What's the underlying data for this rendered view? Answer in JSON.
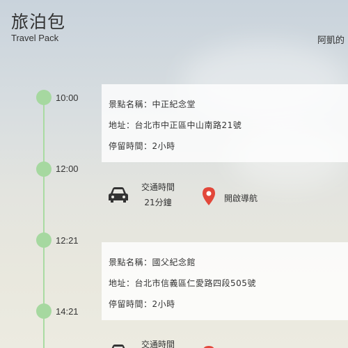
{
  "header": {
    "title": "旅泊包",
    "subtitle": "Travel Pack",
    "user": "阿凱的"
  },
  "timeline": [
    {
      "time": "10:00"
    },
    {
      "time": "12:00"
    },
    {
      "time": "12:21"
    },
    {
      "time": "14:21"
    }
  ],
  "stops": [
    {
      "name": "景點名稱：中正紀念堂",
      "address": "地址：台北市中正區中山南路21號",
      "duration": "停留時間：2小時"
    },
    {
      "name": "景點名稱：國父紀念館",
      "address": "地址：台北市信義區仁愛路四段505號",
      "duration": "停留時間：2小時"
    }
  ],
  "travel": [
    {
      "label": "交通時間",
      "value": "21分鐘",
      "nav_label": "開啟導航"
    },
    {
      "label": "交通時間"
    }
  ],
  "colors": {
    "accent": "#a6d8a0",
    "pin": "#e2473a",
    "car": "#333333"
  }
}
